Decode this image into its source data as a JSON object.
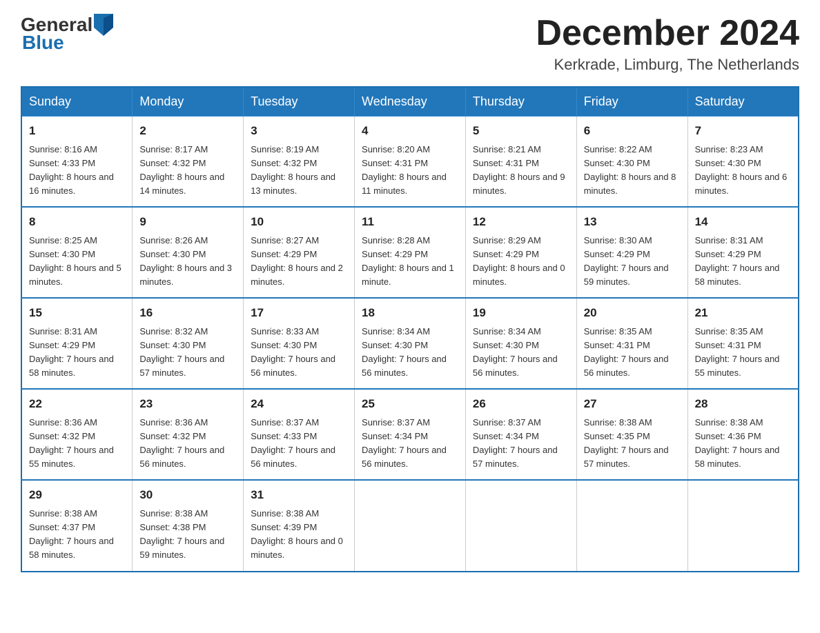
{
  "header": {
    "logo_general": "General",
    "logo_blue": "Blue",
    "title": "December 2024",
    "subtitle": "Kerkrade, Limburg, The Netherlands"
  },
  "columns": [
    "Sunday",
    "Monday",
    "Tuesday",
    "Wednesday",
    "Thursday",
    "Friday",
    "Saturday"
  ],
  "weeks": [
    [
      {
        "day": "1",
        "sunrise": "Sunrise: 8:16 AM",
        "sunset": "Sunset: 4:33 PM",
        "daylight": "Daylight: 8 hours and 16 minutes."
      },
      {
        "day": "2",
        "sunrise": "Sunrise: 8:17 AM",
        "sunset": "Sunset: 4:32 PM",
        "daylight": "Daylight: 8 hours and 14 minutes."
      },
      {
        "day": "3",
        "sunrise": "Sunrise: 8:19 AM",
        "sunset": "Sunset: 4:32 PM",
        "daylight": "Daylight: 8 hours and 13 minutes."
      },
      {
        "day": "4",
        "sunrise": "Sunrise: 8:20 AM",
        "sunset": "Sunset: 4:31 PM",
        "daylight": "Daylight: 8 hours and 11 minutes."
      },
      {
        "day": "5",
        "sunrise": "Sunrise: 8:21 AM",
        "sunset": "Sunset: 4:31 PM",
        "daylight": "Daylight: 8 hours and 9 minutes."
      },
      {
        "day": "6",
        "sunrise": "Sunrise: 8:22 AM",
        "sunset": "Sunset: 4:30 PM",
        "daylight": "Daylight: 8 hours and 8 minutes."
      },
      {
        "day": "7",
        "sunrise": "Sunrise: 8:23 AM",
        "sunset": "Sunset: 4:30 PM",
        "daylight": "Daylight: 8 hours and 6 minutes."
      }
    ],
    [
      {
        "day": "8",
        "sunrise": "Sunrise: 8:25 AM",
        "sunset": "Sunset: 4:30 PM",
        "daylight": "Daylight: 8 hours and 5 minutes."
      },
      {
        "day": "9",
        "sunrise": "Sunrise: 8:26 AM",
        "sunset": "Sunset: 4:30 PM",
        "daylight": "Daylight: 8 hours and 3 minutes."
      },
      {
        "day": "10",
        "sunrise": "Sunrise: 8:27 AM",
        "sunset": "Sunset: 4:29 PM",
        "daylight": "Daylight: 8 hours and 2 minutes."
      },
      {
        "day": "11",
        "sunrise": "Sunrise: 8:28 AM",
        "sunset": "Sunset: 4:29 PM",
        "daylight": "Daylight: 8 hours and 1 minute."
      },
      {
        "day": "12",
        "sunrise": "Sunrise: 8:29 AM",
        "sunset": "Sunset: 4:29 PM",
        "daylight": "Daylight: 8 hours and 0 minutes."
      },
      {
        "day": "13",
        "sunrise": "Sunrise: 8:30 AM",
        "sunset": "Sunset: 4:29 PM",
        "daylight": "Daylight: 7 hours and 59 minutes."
      },
      {
        "day": "14",
        "sunrise": "Sunrise: 8:31 AM",
        "sunset": "Sunset: 4:29 PM",
        "daylight": "Daylight: 7 hours and 58 minutes."
      }
    ],
    [
      {
        "day": "15",
        "sunrise": "Sunrise: 8:31 AM",
        "sunset": "Sunset: 4:29 PM",
        "daylight": "Daylight: 7 hours and 58 minutes."
      },
      {
        "day": "16",
        "sunrise": "Sunrise: 8:32 AM",
        "sunset": "Sunset: 4:30 PM",
        "daylight": "Daylight: 7 hours and 57 minutes."
      },
      {
        "day": "17",
        "sunrise": "Sunrise: 8:33 AM",
        "sunset": "Sunset: 4:30 PM",
        "daylight": "Daylight: 7 hours and 56 minutes."
      },
      {
        "day": "18",
        "sunrise": "Sunrise: 8:34 AM",
        "sunset": "Sunset: 4:30 PM",
        "daylight": "Daylight: 7 hours and 56 minutes."
      },
      {
        "day": "19",
        "sunrise": "Sunrise: 8:34 AM",
        "sunset": "Sunset: 4:30 PM",
        "daylight": "Daylight: 7 hours and 56 minutes."
      },
      {
        "day": "20",
        "sunrise": "Sunrise: 8:35 AM",
        "sunset": "Sunset: 4:31 PM",
        "daylight": "Daylight: 7 hours and 56 minutes."
      },
      {
        "day": "21",
        "sunrise": "Sunrise: 8:35 AM",
        "sunset": "Sunset: 4:31 PM",
        "daylight": "Daylight: 7 hours and 55 minutes."
      }
    ],
    [
      {
        "day": "22",
        "sunrise": "Sunrise: 8:36 AM",
        "sunset": "Sunset: 4:32 PM",
        "daylight": "Daylight: 7 hours and 55 minutes."
      },
      {
        "day": "23",
        "sunrise": "Sunrise: 8:36 AM",
        "sunset": "Sunset: 4:32 PM",
        "daylight": "Daylight: 7 hours and 56 minutes."
      },
      {
        "day": "24",
        "sunrise": "Sunrise: 8:37 AM",
        "sunset": "Sunset: 4:33 PM",
        "daylight": "Daylight: 7 hours and 56 minutes."
      },
      {
        "day": "25",
        "sunrise": "Sunrise: 8:37 AM",
        "sunset": "Sunset: 4:34 PM",
        "daylight": "Daylight: 7 hours and 56 minutes."
      },
      {
        "day": "26",
        "sunrise": "Sunrise: 8:37 AM",
        "sunset": "Sunset: 4:34 PM",
        "daylight": "Daylight: 7 hours and 57 minutes."
      },
      {
        "day": "27",
        "sunrise": "Sunrise: 8:38 AM",
        "sunset": "Sunset: 4:35 PM",
        "daylight": "Daylight: 7 hours and 57 minutes."
      },
      {
        "day": "28",
        "sunrise": "Sunrise: 8:38 AM",
        "sunset": "Sunset: 4:36 PM",
        "daylight": "Daylight: 7 hours and 58 minutes."
      }
    ],
    [
      {
        "day": "29",
        "sunrise": "Sunrise: 8:38 AM",
        "sunset": "Sunset: 4:37 PM",
        "daylight": "Daylight: 7 hours and 58 minutes."
      },
      {
        "day": "30",
        "sunrise": "Sunrise: 8:38 AM",
        "sunset": "Sunset: 4:38 PM",
        "daylight": "Daylight: 7 hours and 59 minutes."
      },
      {
        "day": "31",
        "sunrise": "Sunrise: 8:38 AM",
        "sunset": "Sunset: 4:39 PM",
        "daylight": "Daylight: 8 hours and 0 minutes."
      },
      null,
      null,
      null,
      null
    ]
  ]
}
